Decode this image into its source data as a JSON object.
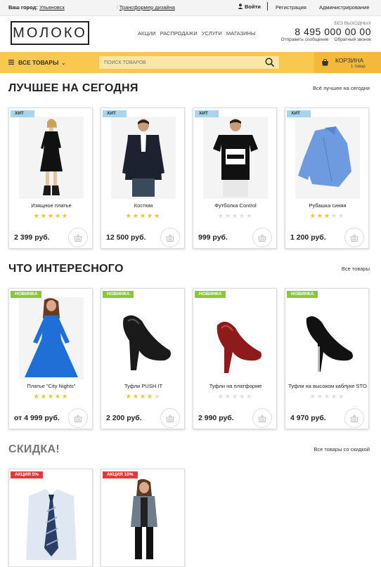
{
  "topbar": {
    "city_label": "Ваш город:",
    "city": "Ульяновск",
    "transformer": "Трансформер дизайна",
    "login": "Войти",
    "register": "Регистрация",
    "admin": "Администрирование"
  },
  "header": {
    "logo": "МОЛОКО",
    "nav": [
      "АКЦИИ",
      "РАСПРОДАЖИ",
      "УСЛУГИ",
      "МАГАЗИНЫ"
    ],
    "phone_note": "БЕЗ ВЫХОДНЫХ",
    "phone": "8 495 000 00 00",
    "send_message": "Отправить сообщение",
    "callback": "Обратный звонок"
  },
  "toolbar": {
    "all_goods": "ВСЕ ТОВАРЫ",
    "search_placeholder": "ПОИСК ТОВАРОВ",
    "cart": "КОРЗИНА",
    "cart_count": "1 товар"
  },
  "sections": [
    {
      "title": "ЛУЧШЕЕ НА СЕГОДНЯ",
      "link": "Всё лучшее на сегодня",
      "products": [
        {
          "badge": "ХИТ",
          "name": "Изящное платье",
          "rating": 5,
          "price": "2 399 руб."
        },
        {
          "badge": "ХИТ",
          "name": "Костюм",
          "rating": 5,
          "price": "12 500 руб."
        },
        {
          "badge": "ХИТ",
          "name": "Футболка Control",
          "rating": 0,
          "price": "999 руб."
        },
        {
          "badge": "ХИТ",
          "name": "Рубашка синяя",
          "rating": 3,
          "price": "1 200 руб."
        }
      ]
    },
    {
      "title": "ЧТО ИНТЕРЕСНОГО",
      "link": "Все товары",
      "products": [
        {
          "badge": "НОВИНКА",
          "name": "Платье \"City Nights\"",
          "rating": 5,
          "price": "от 4 999 руб."
        },
        {
          "badge": "НОВИНКА",
          "name": "Туфли PUSH IT",
          "rating": 4,
          "price": "2 200 руб."
        },
        {
          "badge": "НОВИНКА",
          "name": "Туфли на платформе",
          "rating": 0,
          "price": "2 990 руб."
        },
        {
          "badge": "НОВИНКА",
          "name": "Туфли на высоком каблуке STO",
          "rating": 0,
          "price": "4 970 руб."
        }
      ]
    },
    {
      "title": "СКИДКА!",
      "link": "Все товары со скидкой",
      "products": [
        {
          "badge": "АКЦИЯ 5%"
        },
        {
          "badge": "АКЦИЯ 10%"
        }
      ]
    }
  ],
  "colors": {
    "toolbar_yellow": "#f9c94f",
    "cart_yellow": "#f4b93a",
    "hit_badge": "#a8d4f0",
    "new_badge": "#8cc63f",
    "sale_badge": "#e23a3a",
    "star_on": "#f5c518"
  }
}
